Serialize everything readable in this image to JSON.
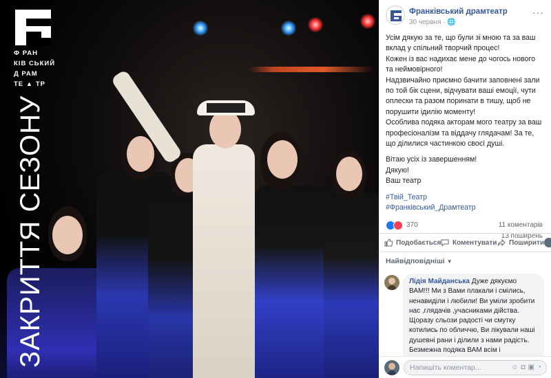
{
  "photo": {
    "brand_lines": [
      "Ф   РАН",
      "КІВ СЬКИЙ",
      "Д   РАМ",
      "ТЕ ▲ ТР"
    ],
    "vertical_title": "ЗАКРИТТЯ СЕЗОНУ"
  },
  "post": {
    "page_name": "Франківський драмтеатр",
    "date": "30 червня",
    "text_paragraphs": [
      "Усім дякую за те, що були зі мною та за ваш вклад у спільний творчий процес!",
      "Кожен із вас надихає мене до чогось нового та неймовірного!",
      "Надзвичайно приємно бачити заповнені зали по той бік сцени, відчувати ваші емоції, чути оплески та разом поринати в тишу, щоб не порушити ідилію моменту!",
      "Особлива подяка акторам мого театру за ваш професіоналізм та віддачу глядачам! За те, що ділилися частинкою своєї душі."
    ],
    "closing_lines": [
      "Вітаю усіх із завершенням!",
      "Дякую!",
      "Ваш театр"
    ],
    "hashtags": [
      "#Твій_Театр",
      "#Франківський_Драмтеатр"
    ],
    "reactions_count": "370",
    "comments_count": "11 коментарів",
    "shares_count": "13 поширень"
  },
  "actions": {
    "like": "Подобається",
    "comment": "Коментувати",
    "share": "Поширити"
  },
  "comments_filter": "Найвідповідніші",
  "comment": {
    "author": "Лідія Майданська",
    "text": "Дуже дякуємо ВАМ!!! Ми з Вами плакали і смілись, ненавиділи і любили! Ви уміли зробити нас ,глядачів ,учасниками дійства. Щоразу сльози радості чи смутку котились по обличчю, Ви лікували наші душевні рани і ділили з нами радість. Безмежна подяка ВАМ всім і КОЖНОМУ окремо. Ми любимо Вас. Гарного відпочинку і до зустрічі, любий"
  },
  "comment_input": {
    "placeholder": "Напишіть коментар..."
  },
  "colors": {
    "link": "#365899",
    "like_blue": "#1877f2",
    "love_red": "#f33e58"
  }
}
